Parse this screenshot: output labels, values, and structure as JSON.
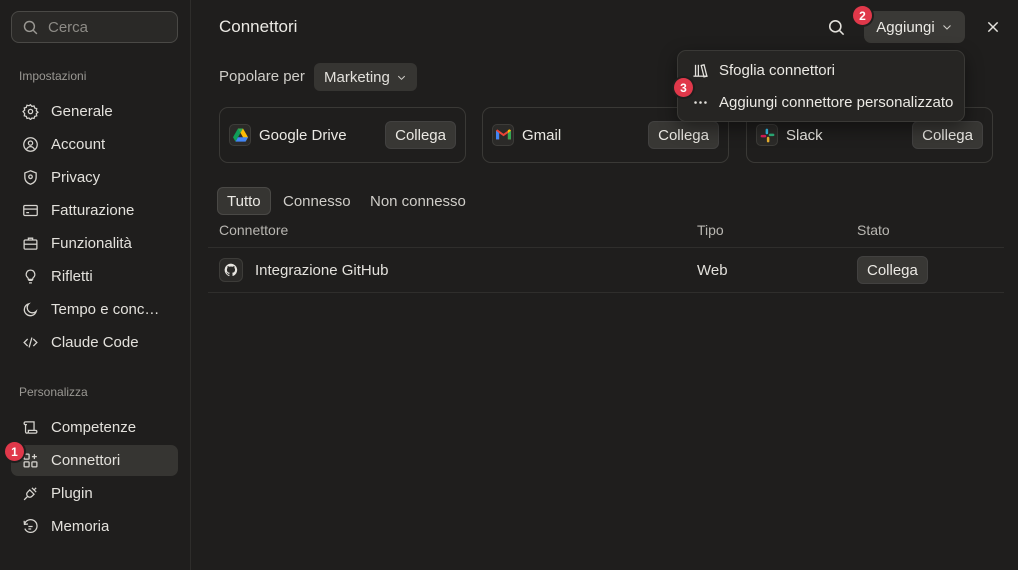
{
  "sidebar": {
    "search_placeholder": "Cerca",
    "section_settings": "Impostazioni",
    "settings_items": [
      {
        "label": "Generale",
        "icon": "gear-icon"
      },
      {
        "label": "Account",
        "icon": "user-circle-icon"
      },
      {
        "label": "Privacy",
        "icon": "shield-icon"
      },
      {
        "label": "Fatturazione",
        "icon": "credit-card-icon"
      },
      {
        "label": "Funzionalità",
        "icon": "briefcase-icon"
      },
      {
        "label": "Rifletti",
        "icon": "lightbulb-icon"
      },
      {
        "label": "Tempo e conce…",
        "icon": "moon-icon"
      },
      {
        "label": "Claude Code",
        "icon": "code-icon"
      }
    ],
    "section_personalize": "Personalizza",
    "personalize_items": [
      {
        "label": "Competenze",
        "icon": "scroll-icon"
      },
      {
        "label": "Connettori",
        "icon": "grid-plus-icon",
        "active": true
      },
      {
        "label": "Plugin",
        "icon": "plug-icon"
      },
      {
        "label": "Memoria",
        "icon": "memory-icon"
      }
    ]
  },
  "header": {
    "title": "Connettori",
    "add_label": "Aggiungi"
  },
  "dropdown": {
    "items": [
      {
        "label": "Sfoglia connettori",
        "icon": "library-icon"
      },
      {
        "label": "Aggiungi connettore personalizzato",
        "icon": "more-horizontal-icon"
      }
    ]
  },
  "popular": {
    "label": "Popolare per",
    "selected": "Marketing"
  },
  "cards": [
    {
      "name": "Google Drive",
      "icon": "google-drive-icon",
      "button": "Collega"
    },
    {
      "name": "Gmail",
      "icon": "gmail-icon",
      "button": "Collega"
    },
    {
      "name": "Slack",
      "icon": "slack-icon",
      "button": "Collega"
    }
  ],
  "tabs": [
    "Tutto",
    "Connesso",
    "Non connesso"
  ],
  "table": {
    "headers": [
      "Connettore",
      "Tipo",
      "Stato"
    ],
    "rows": [
      {
        "name": "Integrazione GitHub",
        "icon": "github-icon",
        "type": "Web",
        "action": "Collega"
      }
    ]
  },
  "markers": [
    "1",
    "2",
    "3"
  ],
  "colors": {
    "background": "#1f1e1d",
    "marker": "#e0384a",
    "active_item": "#363532"
  }
}
